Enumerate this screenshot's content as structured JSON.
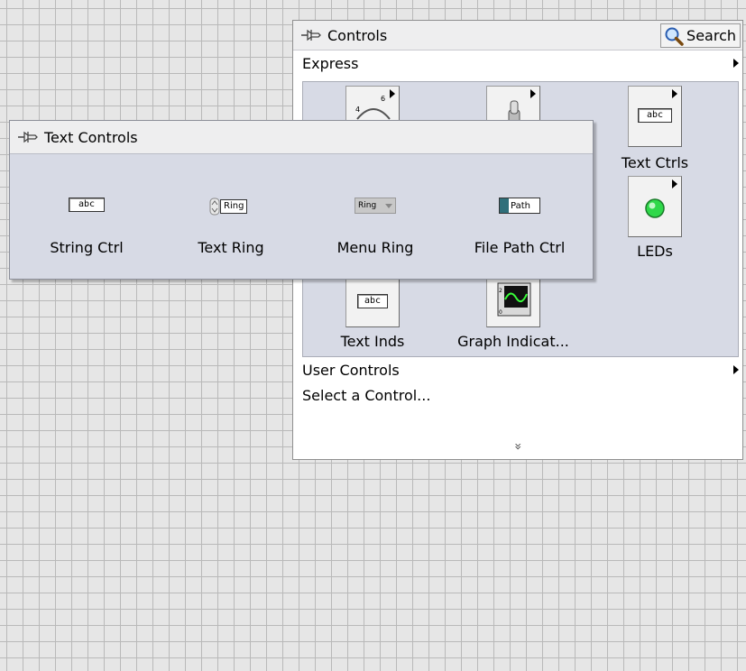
{
  "controls_palette": {
    "title": "Controls",
    "search_label": "Search",
    "express_label": "Express",
    "categories": [
      {
        "label": "Text Ctrls",
        "icon": "text-ctrls-icon"
      },
      {
        "label": "LEDs",
        "icon": "led-icon"
      },
      {
        "label": "Text Inds",
        "icon": "text-inds-icon"
      },
      {
        "label": "Graph Indicat...",
        "icon": "graph-indicator-icon"
      }
    ],
    "text_ctrls_icon_text": "abc",
    "text_inds_icon_text": "abc",
    "user_controls_label": "User Controls",
    "select_control_label": "Select a Control...",
    "expand_glyph": "»"
  },
  "text_controls_palette": {
    "title": "Text Controls",
    "items": [
      {
        "label": "String Ctrl",
        "icon_text": "abc"
      },
      {
        "label": "Text Ring",
        "icon_text": "Ring"
      },
      {
        "label": "Menu Ring",
        "icon_text": "Ring"
      },
      {
        "label": "File Path Ctrl",
        "icon_text": "Path"
      }
    ]
  },
  "colors": {
    "canvas": "#e6e6e6",
    "grid_line": "#b9b9b9",
    "palette_panel": "#d7dae5",
    "header": "#eeeeef",
    "led_green": "#2fd84a"
  }
}
